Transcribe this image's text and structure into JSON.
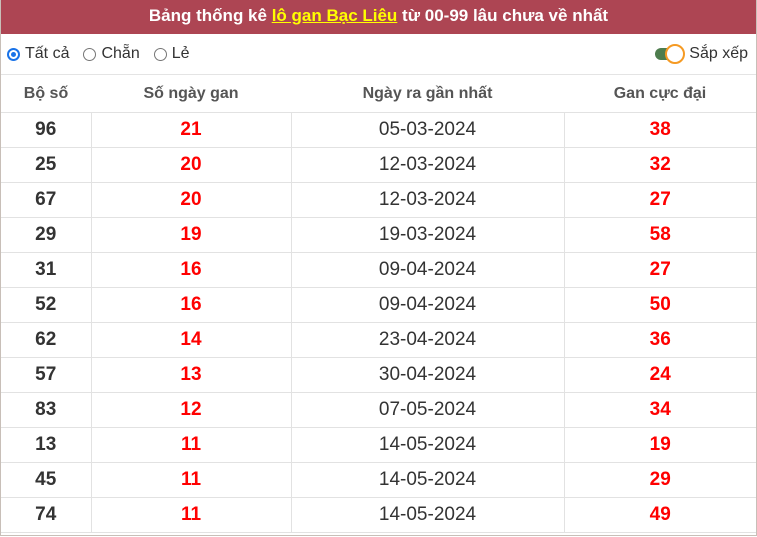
{
  "header": {
    "title_prefix": "Bảng thống kê ",
    "title_link": "lô gan Bạc Liêu",
    "title_suffix": " từ 00-99 lâu chưa về nhất"
  },
  "filters": {
    "options": [
      {
        "label": "Tất cả",
        "checked": true
      },
      {
        "label": "Chẵn",
        "checked": false
      },
      {
        "label": "Lẻ",
        "checked": false
      }
    ],
    "sort_label": "Sắp xếp",
    "sort_enabled": true
  },
  "table": {
    "columns": [
      "Bộ số",
      "Số ngày gan",
      "Ngày ra gần nhất",
      "Gan cực đại"
    ],
    "rows": [
      [
        "96",
        "21",
        "05-03-2024",
        "38"
      ],
      [
        "25",
        "20",
        "12-03-2024",
        "32"
      ],
      [
        "67",
        "20",
        "12-03-2024",
        "27"
      ],
      [
        "29",
        "19",
        "19-03-2024",
        "58"
      ],
      [
        "31",
        "16",
        "09-04-2024",
        "27"
      ],
      [
        "52",
        "16",
        "09-04-2024",
        "50"
      ],
      [
        "62",
        "14",
        "23-04-2024",
        "36"
      ],
      [
        "57",
        "13",
        "30-04-2024",
        "24"
      ],
      [
        "83",
        "12",
        "07-05-2024",
        "34"
      ],
      [
        "13",
        "11",
        "14-05-2024",
        "19"
      ],
      [
        "45",
        "11",
        "14-05-2024",
        "29"
      ],
      [
        "74",
        "11",
        "14-05-2024",
        "49"
      ]
    ]
  },
  "colors": {
    "header_bg": "#ad4553",
    "link_yellow": "#ffff00",
    "value_red": "#ff0000",
    "toggle_green": "#4e7d4e",
    "toggle_knob_border": "#f59a23",
    "radio_blue": "#1a73e8"
  }
}
